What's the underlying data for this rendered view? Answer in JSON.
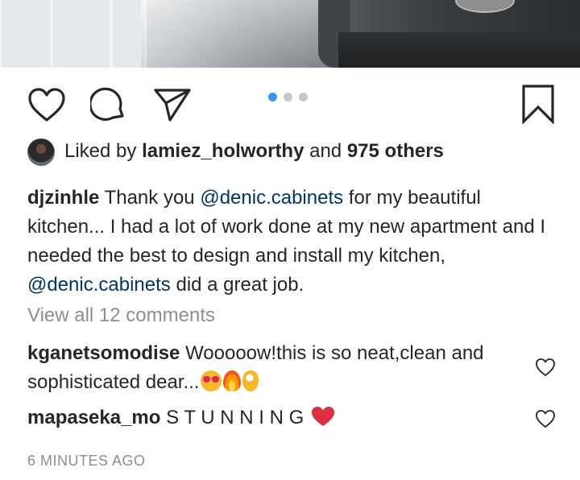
{
  "post": {
    "likes": {
      "prefix": "Liked by",
      "user": "lamiez_holworthy",
      "conj": "and",
      "others": "975 others"
    },
    "caption": {
      "author": "djzinhle",
      "part1": "Thank you",
      "mention1": "@denic.cabinets",
      "part2": "for my beautiful kitchen... I had a lot of work done at my new apartment and I needed the best to design and install my kitchen,",
      "mention2": "@denic.cabinets",
      "part3": "did a great job."
    },
    "view_all_comments": "View all 12 comments",
    "comments": [
      {
        "user": "kganetsomodise",
        "text": "Wooooow!this is so neat,clean and sophisticated dear...",
        "emojis": [
          "heart-eyes-emoji",
          "fire-emoji",
          "ok-hand-emoji"
        ]
      },
      {
        "user": "mapaseka_mo",
        "text": "S T U N N I N G",
        "emojis": [
          "red-heart-emoji"
        ]
      }
    ],
    "timestamp": "6 MINUTES AGO",
    "carousel": {
      "count": 3,
      "active": 1
    }
  },
  "icons": {
    "like": "heart-icon",
    "comment": "comment-bubble-icon",
    "share": "paper-plane-icon",
    "save": "bookmark-icon",
    "comment_like": "heart-icon"
  },
  "colors": {
    "text": "#262626",
    "mention": "#003569",
    "muted": "#8e8e8e",
    "carousel_active": "#3897f0",
    "carousel_inactive": "#c7c7c7"
  }
}
